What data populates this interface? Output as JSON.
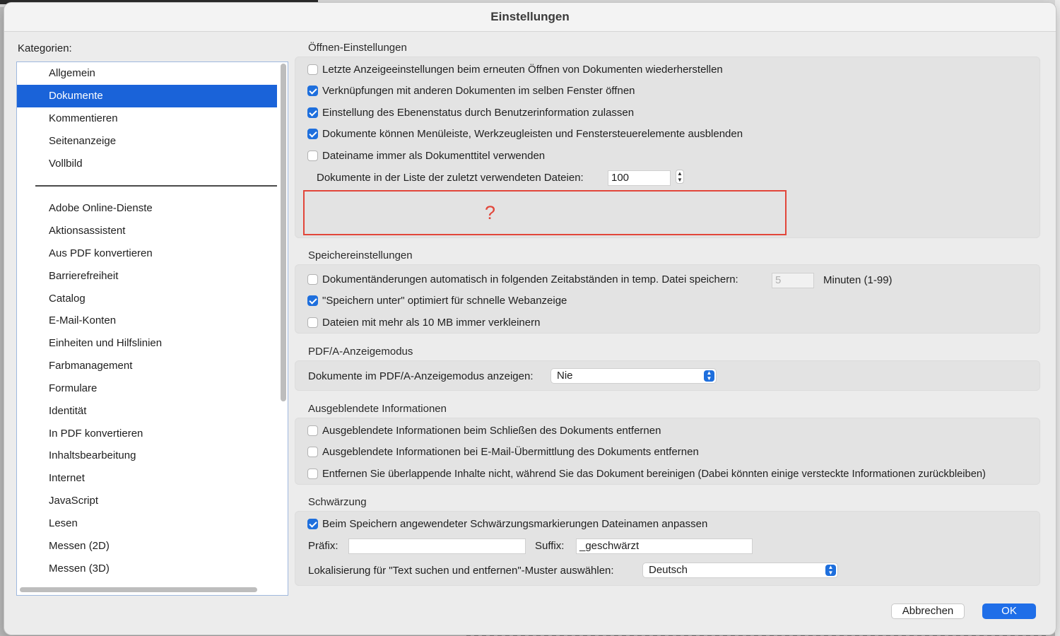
{
  "window": {
    "title": "Einstellungen"
  },
  "categories": {
    "label": "Kategorien:",
    "primary": [
      "Allgemein",
      "Dokumente",
      "Kommentieren",
      "Seitenanzeige",
      "Vollbild"
    ],
    "selected": "Dokumente",
    "secondary": [
      "Adobe Online-Dienste",
      "Aktionsassistent",
      "Aus PDF konvertieren",
      "Barrierefreiheit",
      "Catalog",
      "E-Mail-Konten",
      "Einheiten und Hilfslinien",
      "Farbmanagement",
      "Formulare",
      "Identität",
      "In PDF konvertieren",
      "Inhaltsbearbeitung",
      "Internet",
      "JavaScript",
      "Lesen",
      "Messen (2D)",
      "Messen (3D)"
    ]
  },
  "open_settings": {
    "title": "Öffnen-Einstellungen",
    "options": [
      {
        "label": "Letzte Anzeigeeinstellungen beim erneuten Öffnen von Dokumenten wiederherstellen",
        "checked": false
      },
      {
        "label": "Verknüpfungen mit anderen Dokumenten im selben Fenster öffnen",
        "checked": true
      },
      {
        "label": "Einstellung des Ebenenstatus durch Benutzerinformation zulassen",
        "checked": true
      },
      {
        "label": "Dokumente können Menüleiste, Werkzeugleisten und Fenstersteuerelemente ausblenden",
        "checked": true
      },
      {
        "label": "Dateiname immer als Dokumenttitel verwenden",
        "checked": false
      }
    ],
    "recent_label": "Dokumente in der Liste der zuletzt verwendeten Dateien:",
    "recent_value": "100",
    "hidden_marker": "?"
  },
  "save_settings": {
    "title": "Speichereinstellungen",
    "options": [
      {
        "label": "Dokumentänderungen automatisch in folgenden Zeitabständen in temp. Datei speichern:",
        "checked": false
      },
      {
        "label": "\"Speichern unter\" optimiert für schnelle Webanzeige",
        "checked": true
      },
      {
        "label": "Dateien mit mehr als 10 MB immer verkleinern",
        "checked": false
      }
    ],
    "interval_value": "5",
    "interval_unit": "Minuten (1-99)"
  },
  "pdfa": {
    "title": "PDF/A-Anzeigemodus",
    "label": "Dokumente im PDF/A-Anzeigemodus anzeigen:",
    "value": "Nie"
  },
  "hidden_info": {
    "title": "Ausgeblendete Informationen",
    "options": [
      {
        "label": "Ausgeblendete Informationen beim Schließen des Dokuments entfernen",
        "checked": false
      },
      {
        "label": "Ausgeblendete Informationen bei E-Mail-Übermittlung des Dokuments entfernen",
        "checked": false
      },
      {
        "label": "Entfernen Sie überlappende Inhalte nicht, während Sie das Dokument bereinigen (Dabei könnten einige versteckte Informationen zurückbleiben)",
        "checked": false
      }
    ]
  },
  "redaction": {
    "title": "Schwärzung",
    "option": {
      "label": "Beim Speichern angewendeter Schwärzungsmarkierungen Dateinamen anpassen",
      "checked": true
    },
    "prefix_label": "Präfix:",
    "prefix_value": "",
    "suffix_label": "Suffix:",
    "suffix_value": "_geschwärzt",
    "locale_label": "Lokalisierung für \"Text suchen und entfernen\"-Muster auswählen:",
    "locale_value": "Deutsch"
  },
  "buttons": {
    "cancel": "Abbrechen",
    "ok": "OK"
  },
  "colors": {
    "accent": "#1f6ee8",
    "selection": "#1a63d9",
    "annotation": "#e2463a"
  }
}
